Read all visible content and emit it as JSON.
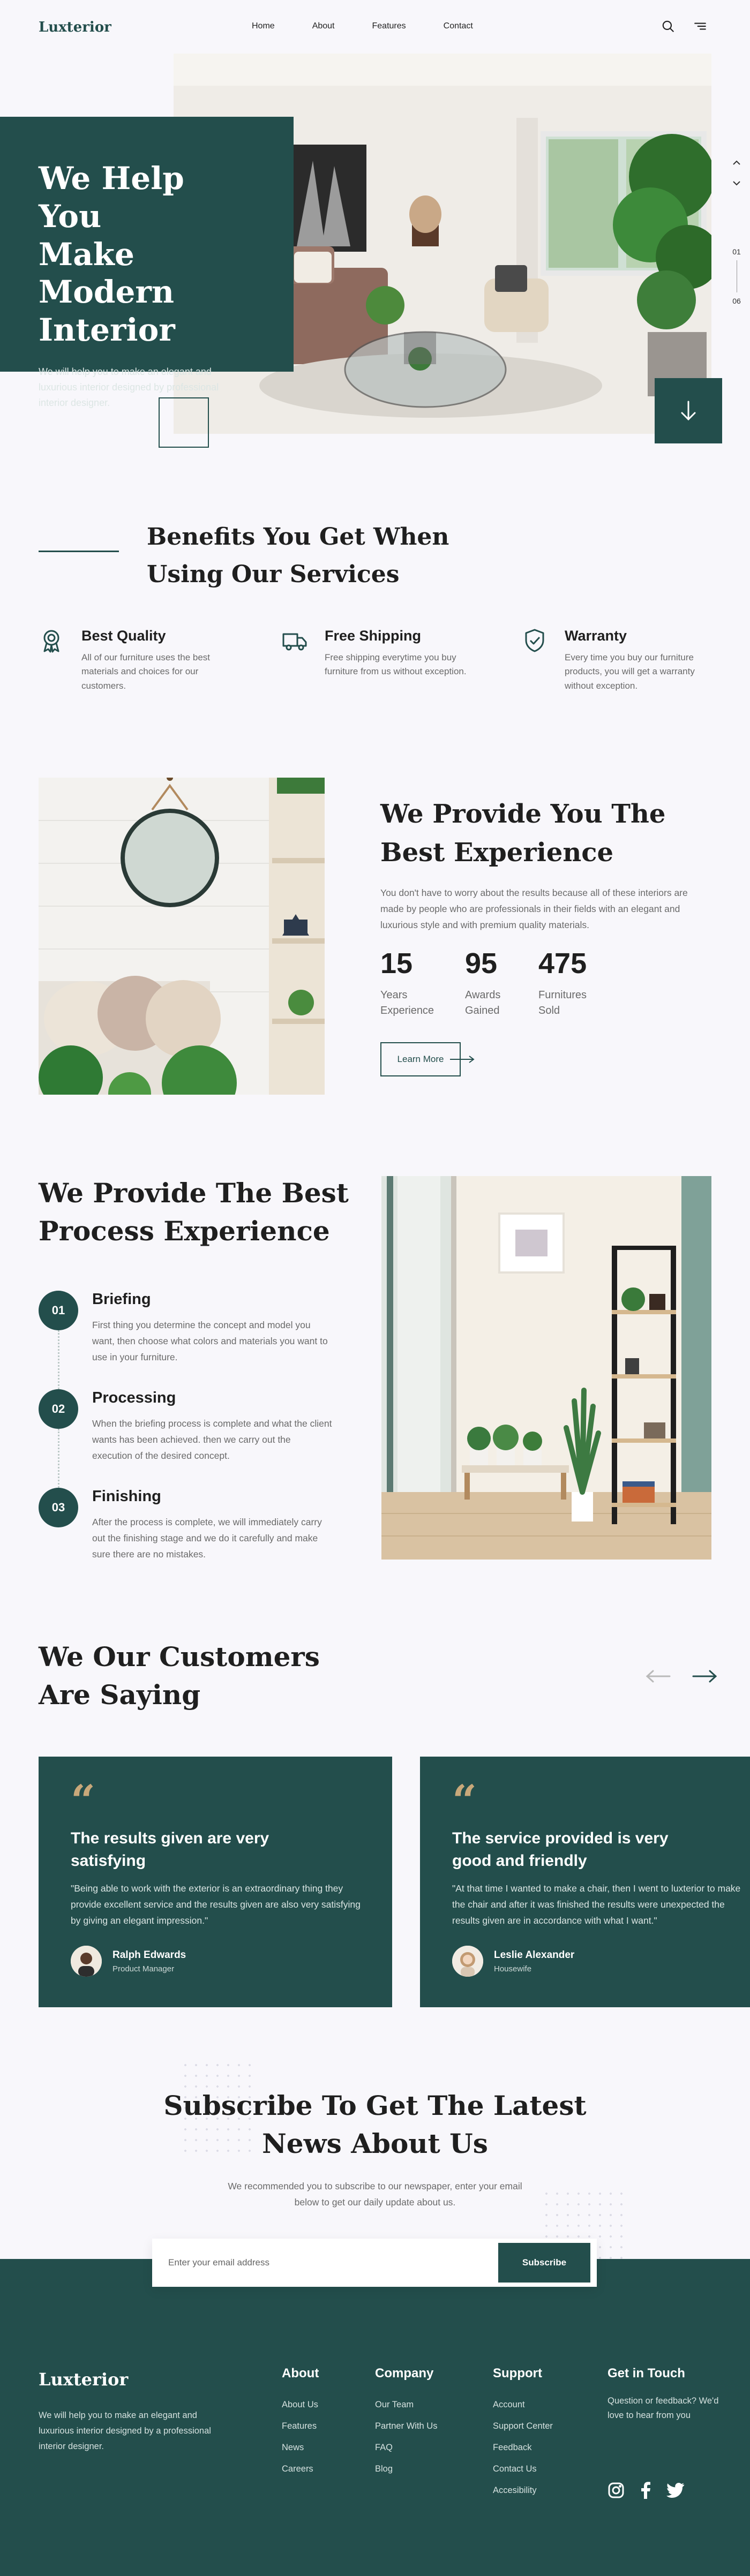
{
  "header": {
    "logo": "Luxterior",
    "nav": [
      "Home",
      "About",
      "Features",
      "Contact"
    ]
  },
  "hero": {
    "title_lines": [
      "We Help You",
      "Make Modern",
      "Interior"
    ],
    "description": "We will help you to make an elegant and luxurious interior designed by professional interior designer.",
    "slide_current": "01",
    "slide_total": "06"
  },
  "benefits": {
    "title_lines": [
      "Benefits You Get When",
      "Using Our Services"
    ],
    "items": [
      {
        "icon": "award-icon",
        "title": "Best Quality",
        "text": "All of our furniture uses the best materials and choices for our customers."
      },
      {
        "icon": "truck-icon",
        "title": "Free Shipping",
        "text": "Free shipping everytime you buy furniture from us without exception."
      },
      {
        "icon": "shield-check-icon",
        "title": "Warranty",
        "text": "Every time you buy our furniture products, you will get a warranty without exception."
      }
    ]
  },
  "experience": {
    "title_lines": [
      "We Provide You The",
      "Best Experience"
    ],
    "description": "You don't have to worry about the results because all of these interiors are made by people who are professionals in their fields with an elegant and luxurious style and with premium quality materials.",
    "stats": [
      {
        "value": "15",
        "label_lines": [
          "Years",
          "Experience"
        ]
      },
      {
        "value": "95",
        "label_lines": [
          "Awards",
          "Gained"
        ]
      },
      {
        "value": "475",
        "label_lines": [
          "Furnitures",
          "Sold"
        ]
      }
    ],
    "cta": "Learn More"
  },
  "process": {
    "title_lines": [
      "We Provide The Best",
      "Process Experience"
    ],
    "steps": [
      {
        "num": "01",
        "title": "Briefing",
        "text": "First thing you determine the concept and model you want, then choose what colors and materials you want to use in your furniture."
      },
      {
        "num": "02",
        "title": "Processing",
        "text": "When the briefing process is complete and what the client wants has been achieved. then we carry out the execution of the desired concept."
      },
      {
        "num": "03",
        "title": "Finishing",
        "text": "After the process is complete, we will immediately carry out the finishing stage and we do it carefully and make sure there are no mistakes."
      }
    ]
  },
  "testimonials": {
    "title_lines": [
      "We Our Customers",
      "Are Saying"
    ],
    "cards": [
      {
        "heading": "The results given are very satisfying",
        "quote": "\"Being able to work with the exterior is an extraordinary thing they provide excellent service and the results given are also very satisfying by giving an elegant impression.\"",
        "name": "Ralph Edwards",
        "role": "Product Manager"
      },
      {
        "heading": "The service provided is very good and friendly",
        "quote": "\"At that time I wanted to make a chair, then I went to luxterior to make the chair and after it was finished the results were unexpected the results given are in accordance with what I want.\"",
        "name": "Leslie Alexander",
        "role": "Housewife"
      }
    ]
  },
  "subscribe": {
    "title_lines": [
      "Subscribe To Get The Latest",
      "News About Us"
    ],
    "description": "We recommended you to subscribe to our newspaper, enter your email below to get our daily update about us.",
    "placeholder": "Enter your email address",
    "button": "Subscribe"
  },
  "footer": {
    "logo": "Luxterior",
    "description": "We will help you to make an elegant and luxurious interior designed by a professional interior designer.",
    "columns": [
      {
        "title": "About",
        "links": [
          "About Us",
          "Features",
          "News",
          "Careers"
        ]
      },
      {
        "title": "Company",
        "links": [
          "Our Team",
          "Partner With Us",
          "FAQ",
          "Blog"
        ]
      },
      {
        "title": "Support",
        "links": [
          "Account",
          "Support Center",
          "Feedback",
          "Contact Us",
          "Accesibility"
        ]
      }
    ],
    "touch_title": "Get in Touch",
    "touch_text": "Question or feedback? We'd love to hear from you",
    "socials": [
      "instagram-icon",
      "facebook-icon",
      "twitter-icon"
    ]
  },
  "colors": {
    "primary": "#234e4c",
    "background": "#f8f7fb",
    "accent_quote": "#c8a87a",
    "text_muted": "#6a6a6a"
  }
}
